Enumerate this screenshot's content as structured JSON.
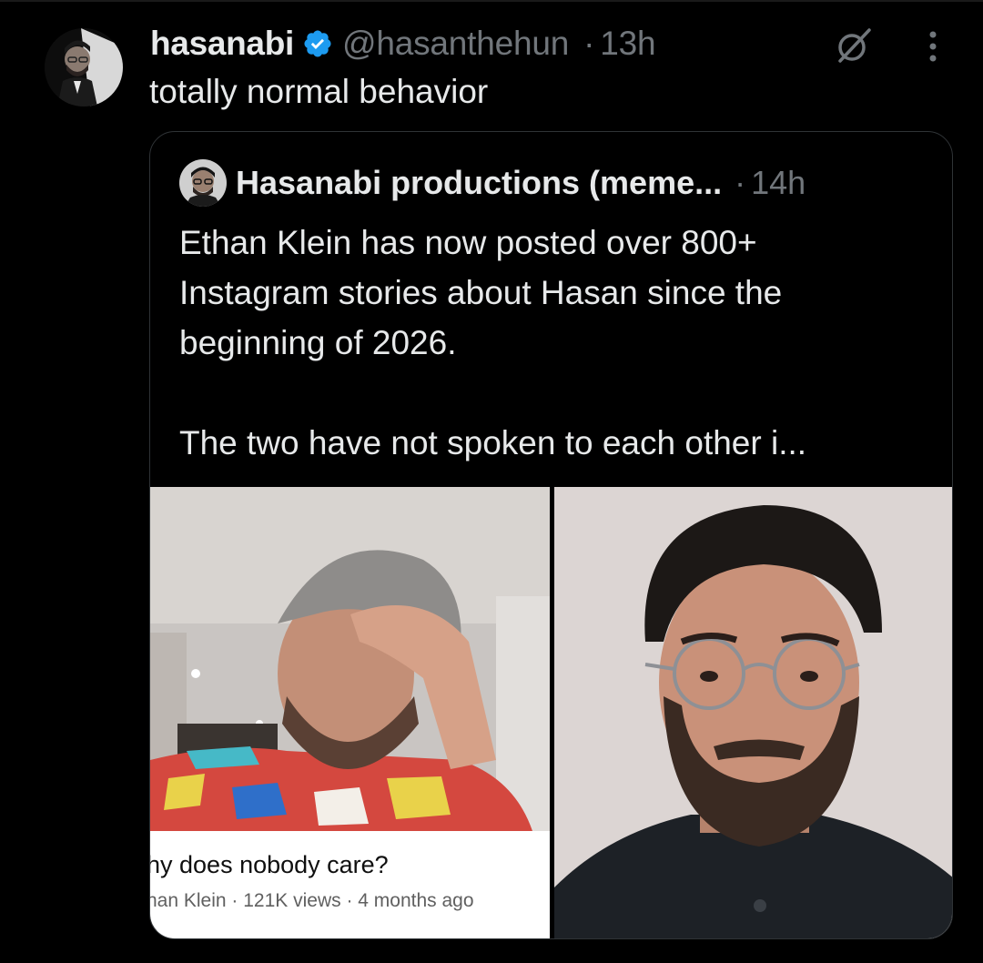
{
  "tweet": {
    "display_name": "hasanabi",
    "handle": "@hasanthehun",
    "time": "13h",
    "text": "totally normal behavior",
    "icons": [
      "verified-badge-icon",
      "grok-icon",
      "more-options-icon"
    ],
    "verified_color": "#1d9bf0"
  },
  "quote": {
    "display_name": "Hasanabi productions (meme...",
    "time": "14h",
    "text_lines": [
      "Ethan Klein has now posted over 800+",
      "Instagram stories about Hasan since the",
      "beginning of 2026.",
      "The two have not spoken to each other i..."
    ]
  },
  "media": {
    "left": {
      "video_title": "hy does nobody care?",
      "video_meta": "han Klein · 121K views · 4 months ago"
    }
  },
  "colors": {
    "background": "#000000",
    "text_primary": "#e7e9ea",
    "text_secondary": "#71767b",
    "border": "#2f3336"
  }
}
